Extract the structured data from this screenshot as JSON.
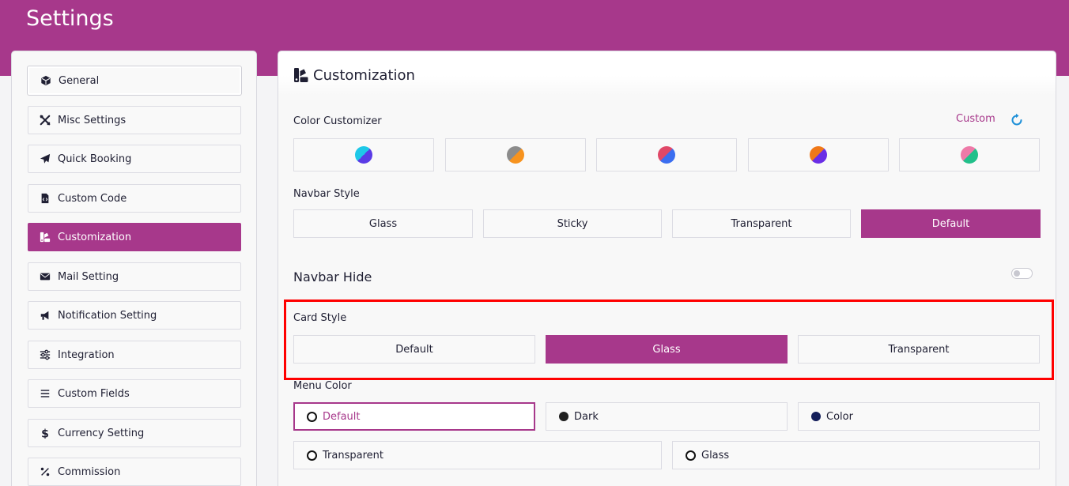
{
  "header": {
    "title": "Settings"
  },
  "sidebar": {
    "items": [
      {
        "label": "General",
        "icon": "cube-icon"
      },
      {
        "label": "Misc Settings",
        "icon": "tools-icon"
      },
      {
        "label": "Quick Booking",
        "icon": "paper-plane-icon"
      },
      {
        "label": "Custom Code",
        "icon": "code-file-icon"
      },
      {
        "label": "Customization",
        "icon": "swatchbook-icon",
        "active": true
      },
      {
        "label": "Mail Setting",
        "icon": "envelope-icon"
      },
      {
        "label": "Notification Setting",
        "icon": "megaphone-icon"
      },
      {
        "label": "Integration",
        "icon": "sliders-icon"
      },
      {
        "label": "Custom Fields",
        "icon": "list-icon"
      },
      {
        "label": "Currency Setting",
        "icon": "dollar-icon"
      },
      {
        "label": "Commission",
        "icon": "percent-icon"
      }
    ]
  },
  "main": {
    "title": "Customization",
    "color_customizer": {
      "label": "Color Customizer",
      "custom_label": "Custom",
      "swatches": [
        {
          "left": "#1ec8e8",
          "right": "#5a3be6"
        },
        {
          "left": "#8c8c8c",
          "right": "#f7931e"
        },
        {
          "left": "#e04868",
          "right": "#3b6ef0"
        },
        {
          "left": "#f07818",
          "right": "#6a2ee6"
        },
        {
          "left": "#ee7aa8",
          "right": "#22c08a"
        }
      ]
    },
    "navbar_style": {
      "label": "Navbar Style",
      "options": [
        "Glass",
        "Sticky",
        "Transparent",
        "Default"
      ],
      "selected": "Default"
    },
    "navbar_hide": {
      "label": "Navbar Hide",
      "enabled": false
    },
    "card_style": {
      "label": "Card Style",
      "options": [
        "Default",
        "Glass",
        "Transparent"
      ],
      "selected": "Glass"
    },
    "menu_color": {
      "label": "Menu Color",
      "options": [
        "Default",
        "Dark",
        "Color",
        "Transparent",
        "Glass"
      ],
      "selected": "Default"
    }
  },
  "colors": {
    "accent": "#a7388b",
    "highlight": "#ff0000"
  }
}
